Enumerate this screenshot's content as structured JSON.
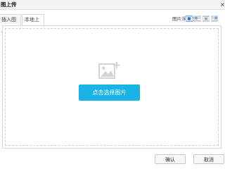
{
  "dialog": {
    "title": "图上传",
    "close_glyph": "×"
  },
  "tabs": [
    {
      "label": "插入图片"
    },
    {
      "label": "本地上传"
    }
  ],
  "float": {
    "label": "图片浮动方式:",
    "options": [
      "none-icon",
      "left-icon",
      "center-icon",
      "right-icon"
    ]
  },
  "upload": {
    "button_label": "点击选择图片",
    "accent": "#1ab3e8"
  },
  "footer": {
    "ok_label": "确认",
    "cancel_label": "取消"
  }
}
